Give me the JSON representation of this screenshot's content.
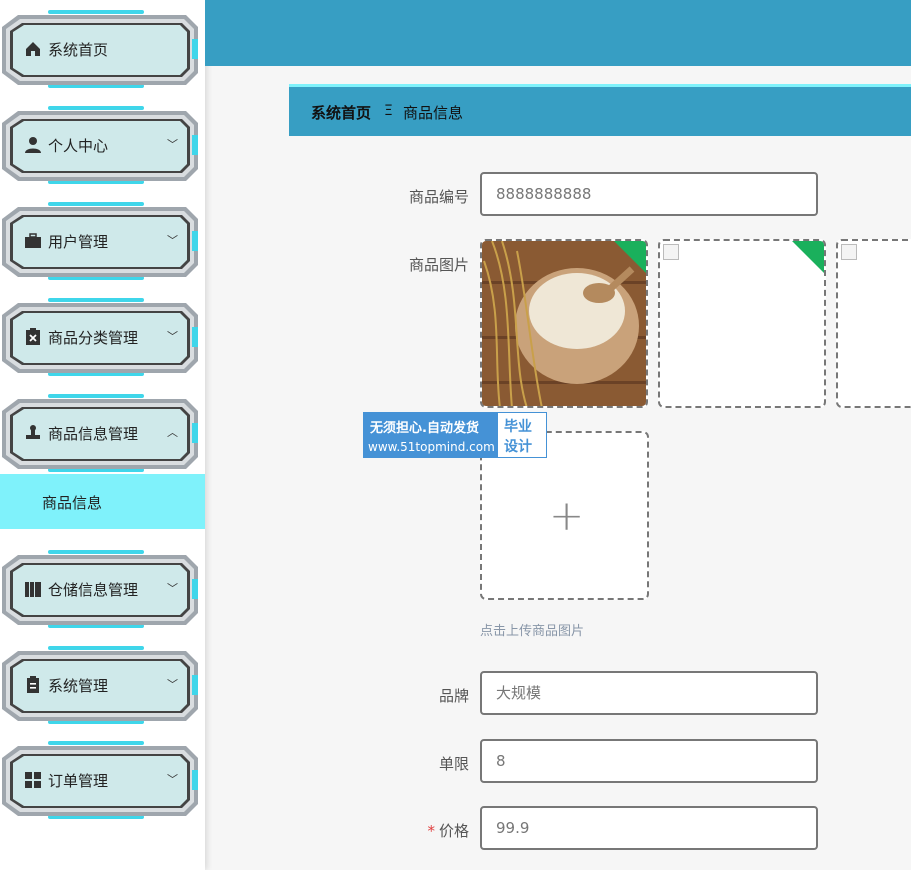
{
  "sidebar": {
    "items": [
      {
        "label": "系统首页",
        "icon": "home-icon",
        "expandable": false
      },
      {
        "label": "个人中心",
        "icon": "user-icon",
        "expandable": true,
        "chevron": "﹀"
      },
      {
        "label": "用户管理",
        "icon": "briefcase-icon",
        "expandable": true,
        "chevron": "﹀"
      },
      {
        "label": "商品分类管理",
        "icon": "clipboard-x-icon",
        "expandable": true,
        "chevron": "﹀"
      },
      {
        "label": "商品信息管理",
        "icon": "stamp-icon",
        "expandable": true,
        "chevron": "︿"
      },
      {
        "label": "仓储信息管理",
        "icon": "books-icon",
        "expandable": true,
        "chevron": "﹀"
      },
      {
        "label": "系统管理",
        "icon": "document-icon",
        "expandable": true,
        "chevron": "﹀"
      },
      {
        "label": "订单管理",
        "icon": "grid-icon",
        "expandable": true,
        "chevron": "﹀"
      }
    ],
    "submenu": {
      "label": "商品信息"
    }
  },
  "breadcrumb": {
    "home": "系统首页",
    "separator": "Ξ",
    "current": "商品信息"
  },
  "form": {
    "code": {
      "label": "商品编号",
      "value": "8888888888"
    },
    "images": {
      "label": "商品图片",
      "hint": "点击上传商品图片",
      "plus": "+"
    },
    "brand": {
      "label": "品牌",
      "value": "大规模"
    },
    "limit": {
      "label": "单限",
      "value": "8"
    },
    "price": {
      "label": "价格",
      "required_mark": "*",
      "value": "99.9"
    }
  },
  "watermark": {
    "line1": "无须担心.自动发货",
    "line2": "www.51topmind.com",
    "box1": "毕业",
    "box2": "设计"
  },
  "colors": {
    "accent": "#379ec3",
    "highlight": "#7ff2fb",
    "corner": "#1ab05c"
  }
}
